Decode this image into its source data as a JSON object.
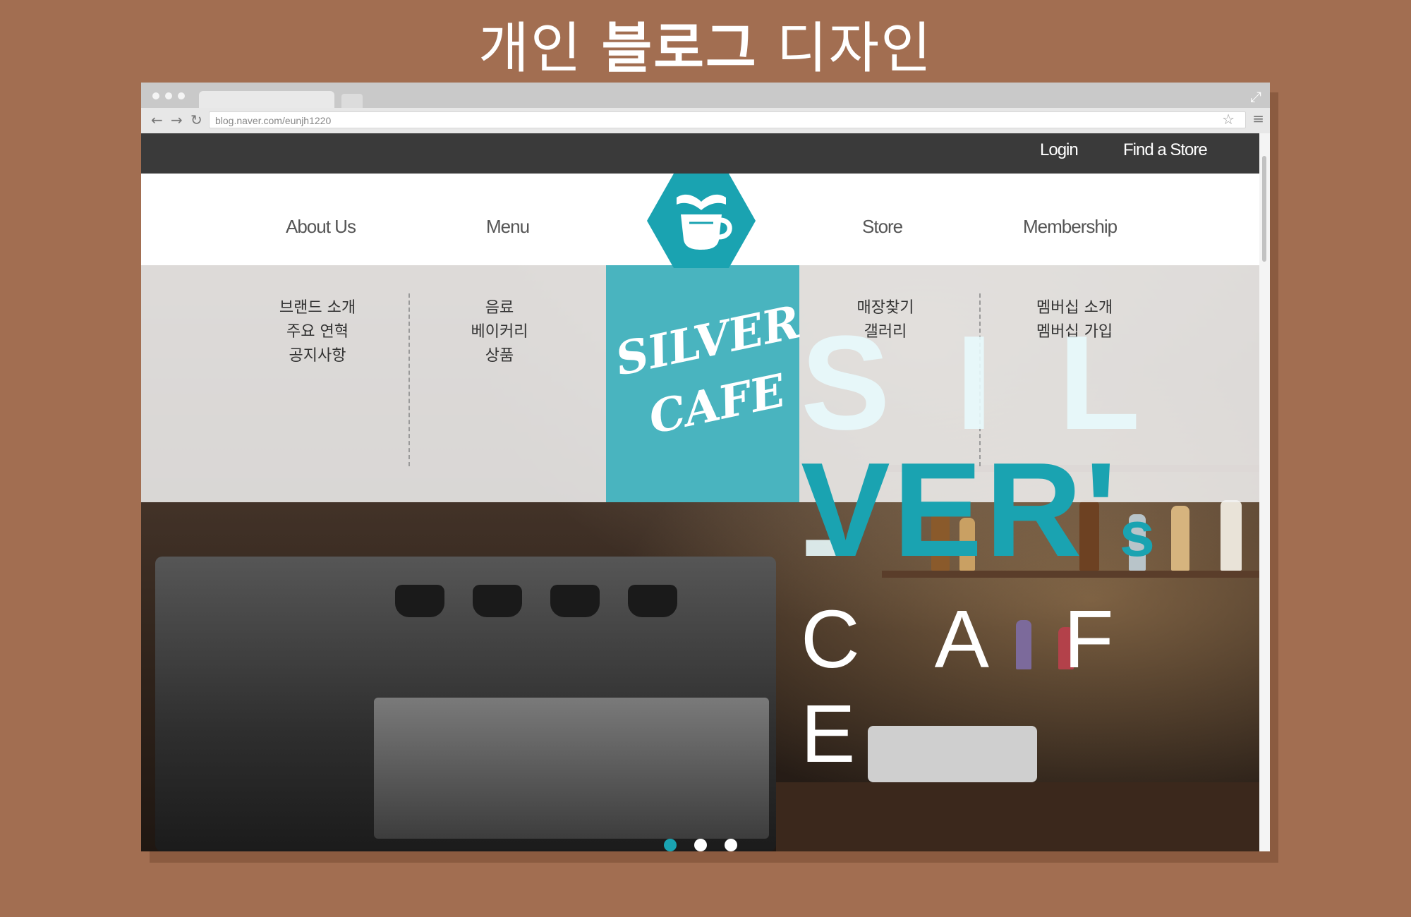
{
  "heading": {
    "light_1": "개인",
    "bold": "블로그",
    "light_2": "디자인"
  },
  "browser": {
    "url": "blog.naver.com/eunjh1220",
    "icons": {
      "back": "←",
      "forward": "→",
      "reload": "↻",
      "star": "☆",
      "menu": "≡",
      "expand": "⤢"
    }
  },
  "site": {
    "topbar": {
      "login": "Login",
      "find_store": "Find a Store"
    },
    "nav": {
      "about": "About Us",
      "menu": "Menu",
      "store": "Store",
      "membership": "Membership"
    },
    "submenus": {
      "about": [
        "브랜드 소개",
        "주요 연혁",
        "공지사항"
      ],
      "menu": [
        "음료",
        "베이커리",
        "상품"
      ],
      "store": [
        "매장찾기",
        "갤러리"
      ],
      "membership": [
        "멤버십 소개",
        "멤버십 가입"
      ]
    },
    "logo": {
      "line1": "SILVER",
      "line2": "CAFE"
    },
    "hero": {
      "line1": "S I L -",
      "line2": "VER's",
      "line2_main": "VER'",
      "line2_small": "s",
      "line3": "C A F E"
    },
    "slider": {
      "count": 3,
      "active_index": 0
    },
    "colors": {
      "accent": "#1AA3B1",
      "logo_panel": "#49B4BF",
      "topbar": "#3A3A3A",
      "background": "#A26E51"
    }
  }
}
